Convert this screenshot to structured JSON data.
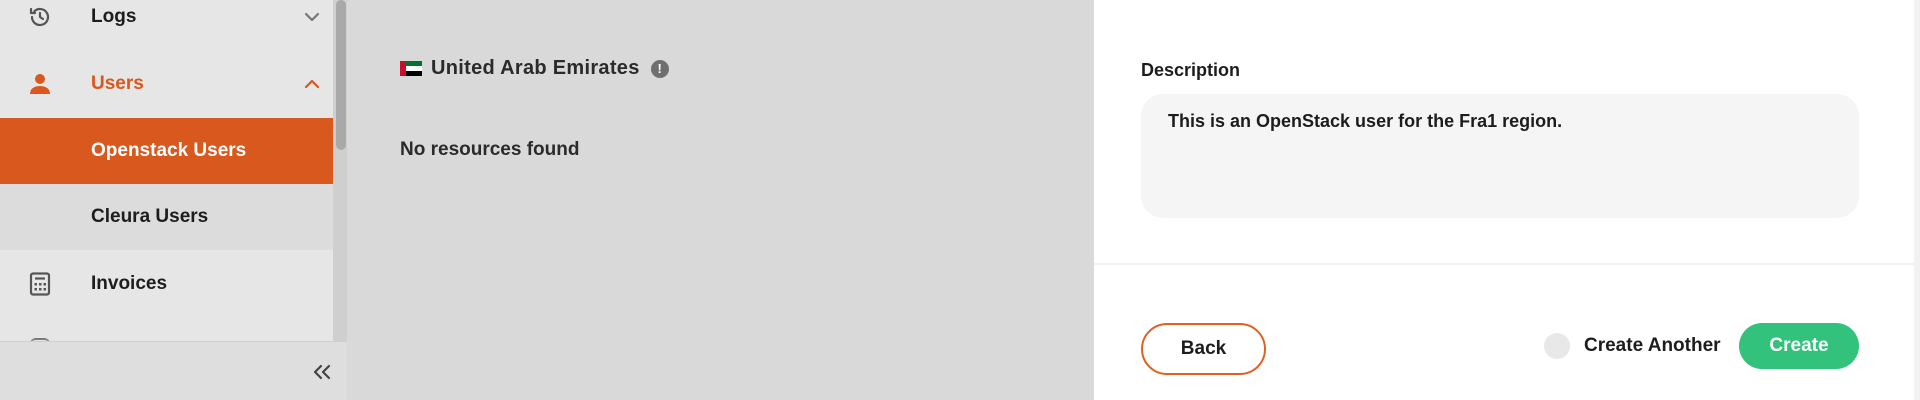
{
  "sidebar": {
    "items": [
      {
        "label": "Logs",
        "icon": "history-icon"
      },
      {
        "label": "Users",
        "icon": "user-icon"
      },
      {
        "label": "Openstack Users"
      },
      {
        "label": "Cleura Users"
      },
      {
        "label": "Invoices",
        "icon": "calculator-icon"
      }
    ],
    "accent_color": "#d9581e"
  },
  "main": {
    "region_name": "United Arab Emirates",
    "region_flag": "uae-flag-icon",
    "info_glyph": "!",
    "no_resources": "No resources found"
  },
  "panel": {
    "description_label": "Description",
    "description_value": "This is an OpenStack user for the Fra1 region.",
    "back_label": "Back",
    "create_another_label": "Create Another",
    "create_label": "Create",
    "create_color": "#33c27c"
  }
}
